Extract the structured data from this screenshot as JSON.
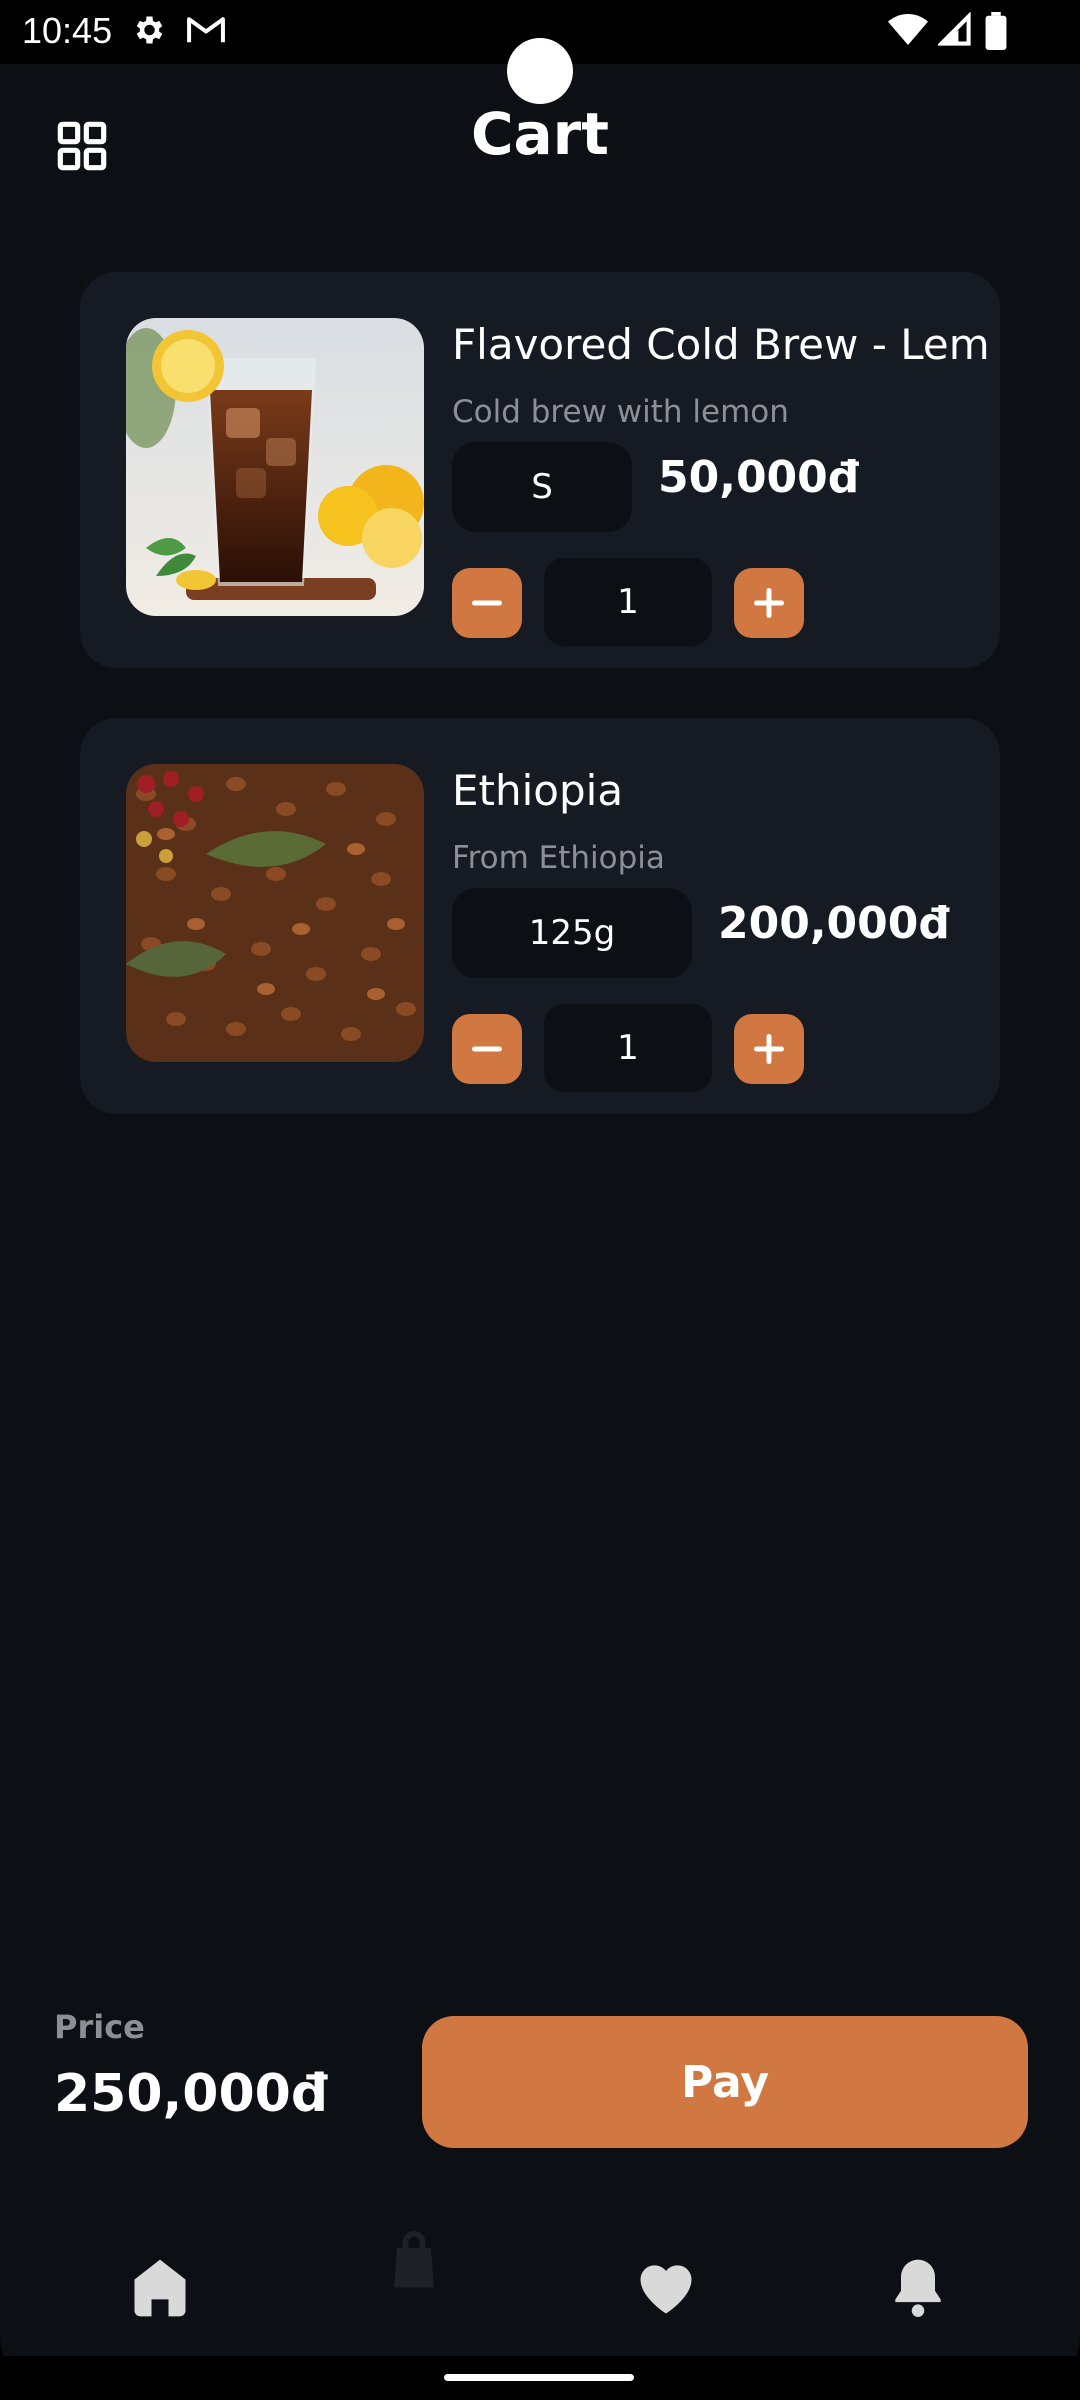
{
  "status_bar": {
    "time": "10:45",
    "icons": [
      "gear-icon",
      "gmail-icon",
      "wifi-icon",
      "signal-icon",
      "battery-icon"
    ]
  },
  "header": {
    "title": "Cart",
    "menu_icon": "grid-icon"
  },
  "cart_items": [
    {
      "name": "Flavored Cold Brew - Lem",
      "description": "Cold brew with lemon",
      "size": "S",
      "price": "50,000đ",
      "quantity": "1",
      "image": "iced-coffee-lemon-image"
    },
    {
      "name": "Ethiopia",
      "description": "From Ethiopia",
      "size": "125g",
      "price": "200,000đ",
      "quantity": "1",
      "image": "coffee-beans-image"
    }
  ],
  "summary": {
    "price_label": "Price",
    "total": "250,000đ",
    "pay_label": "Pay"
  },
  "bottom_nav": {
    "items": [
      "home-icon",
      "shopping-bag-icon",
      "heart-icon",
      "bell-icon"
    ],
    "active": "shopping-bag-icon"
  },
  "colors": {
    "background": "#0c0f14",
    "card": "#161b23",
    "accent": "#d17842",
    "muted_text": "#8c8f95",
    "nav_icon": "#d9d9d9",
    "nav_icon_active": "#1e2228"
  }
}
